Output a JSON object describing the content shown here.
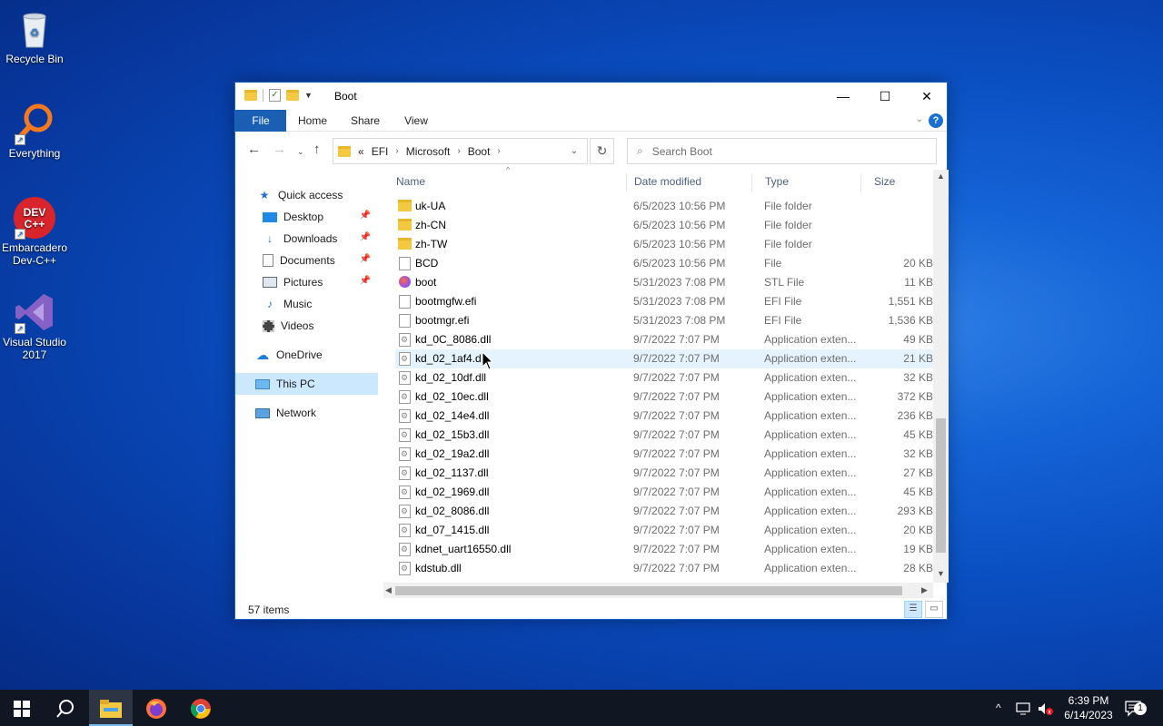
{
  "desktop": {
    "icons": [
      {
        "label": "Recycle Bin",
        "icon": "recycle-bin-icon"
      },
      {
        "label": "Everything",
        "icon": "everything-search-icon"
      },
      {
        "label": "Embarcadero Dev-C++",
        "icon": "devcpp-icon",
        "badge": "DEV C++"
      },
      {
        "label": "Visual Studio 2017",
        "icon": "visual-studio-icon"
      }
    ]
  },
  "window": {
    "title": "Boot",
    "controls": {
      "minimize": "—",
      "maximize": "☐",
      "close": "✕"
    },
    "ribbon_tabs": [
      "File",
      "Home",
      "Share",
      "View"
    ],
    "address": {
      "prefix": "«",
      "crumbs": [
        "EFI",
        "Microsoft",
        "Boot"
      ]
    },
    "search_placeholder": "Search Boot",
    "nav_pane": {
      "quick_access": "Quick access",
      "items": [
        "Desktop",
        "Downloads",
        "Documents",
        "Pictures",
        "Music",
        "Videos"
      ],
      "onedrive": "OneDrive",
      "this_pc": "This PC",
      "network": "Network"
    },
    "columns": [
      "Name",
      "Date modified",
      "Type",
      "Size"
    ],
    "files": [
      {
        "name": "uk-UA",
        "date": "6/5/2023 10:56 PM",
        "type": "File folder",
        "size": "",
        "kind": "folder"
      },
      {
        "name": "zh-CN",
        "date": "6/5/2023 10:56 PM",
        "type": "File folder",
        "size": "",
        "kind": "folder"
      },
      {
        "name": "zh-TW",
        "date": "6/5/2023 10:56 PM",
        "type": "File folder",
        "size": "",
        "kind": "folder"
      },
      {
        "name": "BCD",
        "date": "6/5/2023 10:56 PM",
        "type": "File",
        "size": "20 KB",
        "kind": "file"
      },
      {
        "name": "boot",
        "date": "5/31/2023 7:08 PM",
        "type": "STL File",
        "size": "11 KB",
        "kind": "stl"
      },
      {
        "name": "bootmgfw.efi",
        "date": "5/31/2023 7:08 PM",
        "type": "EFI File",
        "size": "1,551 KB",
        "kind": "file"
      },
      {
        "name": "bootmgr.efi",
        "date": "5/31/2023 7:08 PM",
        "type": "EFI File",
        "size": "1,536 KB",
        "kind": "file"
      },
      {
        "name": "kd_0C_8086.dll",
        "date": "9/7/2022 7:07 PM",
        "type": "Application exten...",
        "size": "49 KB",
        "kind": "dll"
      },
      {
        "name": "kd_02_1af4.dll",
        "date": "9/7/2022 7:07 PM",
        "type": "Application exten...",
        "size": "21 KB",
        "kind": "dll"
      },
      {
        "name": "kd_02_10df.dll",
        "date": "9/7/2022 7:07 PM",
        "type": "Application exten...",
        "size": "32 KB",
        "kind": "dll"
      },
      {
        "name": "kd_02_10ec.dll",
        "date": "9/7/2022 7:07 PM",
        "type": "Application exten...",
        "size": "372 KB",
        "kind": "dll"
      },
      {
        "name": "kd_02_14e4.dll",
        "date": "9/7/2022 7:07 PM",
        "type": "Application exten...",
        "size": "236 KB",
        "kind": "dll"
      },
      {
        "name": "kd_02_15b3.dll",
        "date": "9/7/2022 7:07 PM",
        "type": "Application exten...",
        "size": "45 KB",
        "kind": "dll"
      },
      {
        "name": "kd_02_19a2.dll",
        "date": "9/7/2022 7:07 PM",
        "type": "Application exten...",
        "size": "32 KB",
        "kind": "dll"
      },
      {
        "name": "kd_02_1137.dll",
        "date": "9/7/2022 7:07 PM",
        "type": "Application exten...",
        "size": "27 KB",
        "kind": "dll"
      },
      {
        "name": "kd_02_1969.dll",
        "date": "9/7/2022 7:07 PM",
        "type": "Application exten...",
        "size": "45 KB",
        "kind": "dll"
      },
      {
        "name": "kd_02_8086.dll",
        "date": "9/7/2022 7:07 PM",
        "type": "Application exten...",
        "size": "293 KB",
        "kind": "dll"
      },
      {
        "name": "kd_07_1415.dll",
        "date": "9/7/2022 7:07 PM",
        "type": "Application exten...",
        "size": "20 KB",
        "kind": "dll"
      },
      {
        "name": "kdnet_uart16550.dll",
        "date": "9/7/2022 7:07 PM",
        "type": "Application exten...",
        "size": "19 KB",
        "kind": "dll"
      },
      {
        "name": "kdstub.dll",
        "date": "9/7/2022 7:07 PM",
        "type": "Application exten...",
        "size": "28 KB",
        "kind": "dll"
      }
    ],
    "hovered_file": "kd_02_1af4.dll",
    "status": "57 items"
  },
  "taskbar": {
    "time": "6:39 PM",
    "date": "6/14/2023",
    "notification_count": "1",
    "apps": [
      "start-icon",
      "search-icon",
      "file-explorer-icon",
      "firefox-icon",
      "chrome-icon"
    ]
  },
  "colors": {
    "accent": "#1a5fb4",
    "selection": "#cce8ff",
    "hover": "#e5f3ff"
  }
}
